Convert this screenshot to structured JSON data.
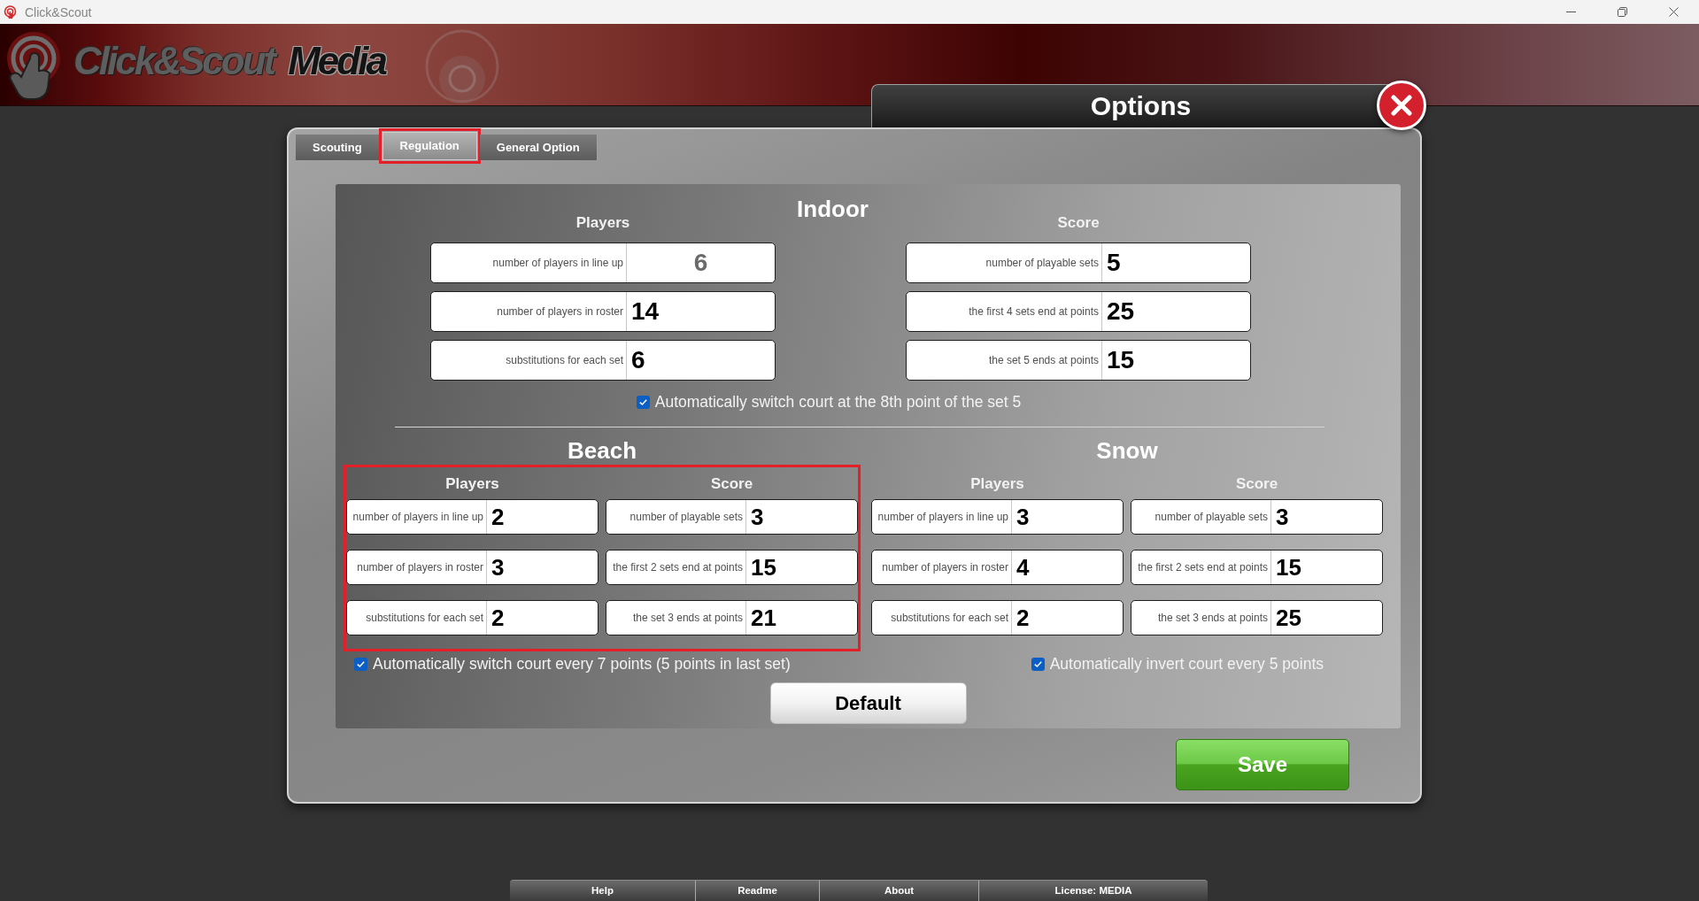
{
  "window": {
    "title": "Click&Scout"
  },
  "banner": {
    "brand": "Click&Scout",
    "product": "Media"
  },
  "dialog": {
    "title": "Options",
    "tabs": [
      {
        "label": "Scouting",
        "selected": false,
        "highlighted": false
      },
      {
        "label": "Regulation",
        "selected": true,
        "highlighted": true
      },
      {
        "label": "General Option",
        "selected": false,
        "highlighted": false
      }
    ],
    "sections": [
      {
        "kind": "wide",
        "title": "Indoor",
        "highlighted": false,
        "groups": [
          {
            "title": "Players",
            "fields": [
              {
                "label": "number of players in line up",
                "value": "6",
                "disabled": true
              },
              {
                "label": "number of players in roster",
                "value": "14",
                "disabled": false
              },
              {
                "label": "substitutions for each set",
                "value": "6",
                "disabled": false
              }
            ]
          },
          {
            "title": "Score",
            "fields": [
              {
                "label": "number of playable sets",
                "value": "5",
                "disabled": false
              },
              {
                "label": "the first 4 sets end at points",
                "value": "25",
                "disabled": false
              },
              {
                "label": "the set 5 ends at points",
                "value": "15",
                "disabled": false
              }
            ]
          }
        ],
        "option": {
          "label": "Automatically switch court at the 8th point of the set 5",
          "checked": true
        }
      },
      {
        "kind": "compact",
        "title": "Beach",
        "highlighted": true,
        "groups": [
          {
            "title": "Players",
            "fields": [
              {
                "label": "number of players in line up",
                "value": "2",
                "disabled": false
              },
              {
                "label": "number of players in roster",
                "value": "3",
                "disabled": false
              },
              {
                "label": "substitutions for each set",
                "value": "2",
                "disabled": false
              }
            ]
          },
          {
            "title": "Score",
            "fields": [
              {
                "label": "number of playable sets",
                "value": "3",
                "disabled": false
              },
              {
                "label": "the first 2 sets end at points",
                "value": "15",
                "disabled": false
              },
              {
                "label": "the set 3 ends at points",
                "value": "21",
                "disabled": false
              }
            ]
          }
        ],
        "option": {
          "label": "Automatically switch court every 7 points (5 points in last set)",
          "checked": true
        }
      },
      {
        "kind": "compact",
        "title": "Snow",
        "highlighted": false,
        "groups": [
          {
            "title": "Players",
            "fields": [
              {
                "label": "number of players in line up",
                "value": "3",
                "disabled": false
              },
              {
                "label": "number of players in roster",
                "value": "4",
                "disabled": false
              },
              {
                "label": "substitutions for each set",
                "value": "2",
                "disabled": false
              }
            ]
          },
          {
            "title": "Score",
            "fields": [
              {
                "label": "number of playable sets",
                "value": "3",
                "disabled": false
              },
              {
                "label": "the first 2 sets end at points",
                "value": "15",
                "disabled": false
              },
              {
                "label": "the set 3 ends at points",
                "value": "25",
                "disabled": false
              }
            ]
          }
        ],
        "option": {
          "label": "Automatically invert court every 5 points",
          "checked": true
        }
      }
    ],
    "default_button": {
      "label": "Default"
    },
    "save_button": {
      "label": "Save"
    }
  },
  "footer": {
    "items": [
      "Help",
      "Readme",
      "About",
      "License: MEDIA"
    ]
  }
}
